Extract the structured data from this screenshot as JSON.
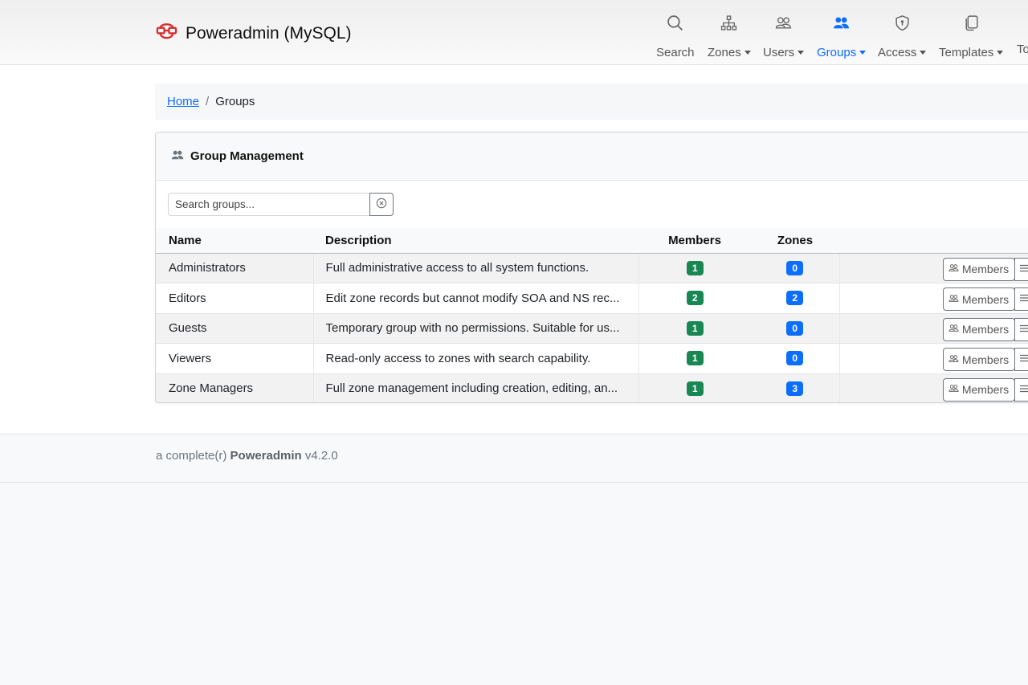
{
  "app": {
    "brand": "Poweradmin (MySQL)",
    "brand_color": "#d32f2f"
  },
  "nav": {
    "items": [
      {
        "label": "Search",
        "icon": "search-icon",
        "dropdown": false,
        "active": false
      },
      {
        "label": "Zones",
        "icon": "sitemap-icon",
        "dropdown": true,
        "active": false
      },
      {
        "label": "Users",
        "icon": "users-icon",
        "dropdown": true,
        "active": false
      },
      {
        "label": "Groups",
        "icon": "groups-icon",
        "dropdown": true,
        "active": true
      },
      {
        "label": "Access",
        "icon": "shield-icon",
        "dropdown": true,
        "active": false
      },
      {
        "label": "Templates",
        "icon": "copy-icon",
        "dropdown": true,
        "active": false
      },
      {
        "label": "To",
        "icon": "",
        "dropdown": false,
        "active": false
      }
    ],
    "active_color": "#0d6efd"
  },
  "breadcrumb": {
    "home": "Home",
    "separator": "/",
    "current": "Groups"
  },
  "card": {
    "title": "Group Management",
    "search_placeholder": "Search groups..."
  },
  "table": {
    "headers": {
      "name": "Name",
      "description": "Description",
      "members": "Members",
      "zones": "Zones"
    },
    "rows": [
      {
        "name": "Administrators",
        "description": "Full administrative access to all system functions.",
        "members": "1",
        "zones": "0",
        "members_button": "Members"
      },
      {
        "name": "Editors",
        "description": "Edit zone records but cannot modify SOA and NS rec...",
        "members": "2",
        "zones": "2",
        "members_button": "Members"
      },
      {
        "name": "Guests",
        "description": "Temporary group with no permissions. Suitable for us...",
        "members": "1",
        "zones": "0",
        "members_button": "Members"
      },
      {
        "name": "Viewers",
        "description": "Read-only access to zones with search capability.",
        "members": "1",
        "zones": "0",
        "members_button": "Members"
      },
      {
        "name": "Zone Managers",
        "description": "Full zone management including creation, editing, an...",
        "members": "1",
        "zones": "3",
        "members_button": "Members"
      }
    ],
    "member_badge_color": "#198754",
    "zone_badge_color": "#0d6efd"
  },
  "footer": {
    "prefix": "a complete(r)",
    "product": "Poweradmin",
    "version": "v4.2.0"
  }
}
